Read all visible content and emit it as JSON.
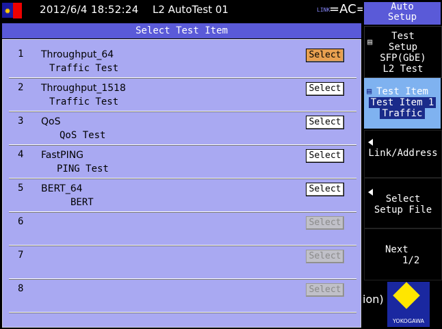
{
  "status": {
    "datetime": "2012/6/4 18:52:24",
    "title": "L2 AutoTest 01",
    "link_indicator": "LINK",
    "power": "=AC="
  },
  "header": {
    "title": "Select Test Item"
  },
  "items": [
    {
      "num": "1",
      "name": "Throughput_64",
      "desc": "Traffic Test",
      "btn": "Select"
    },
    {
      "num": "2",
      "name": "Throughput_1518",
      "desc": "Traffic Test",
      "btn": "Select"
    },
    {
      "num": "3",
      "name": "QoS",
      "desc": "QoS Test",
      "btn": "Select"
    },
    {
      "num": "4",
      "name": "FastPING",
      "desc": "PING Test",
      "btn": "Select"
    },
    {
      "num": "5",
      "name": "BERT_64",
      "desc": "BERT",
      "btn": "Select"
    },
    {
      "num": "6",
      "name": "",
      "desc": "",
      "btn": "Select"
    },
    {
      "num": "7",
      "name": "",
      "desc": "",
      "btn": "Select"
    },
    {
      "num": "8",
      "name": "",
      "desc": "",
      "btn": "Select"
    }
  ],
  "softkeys": {
    "auto_setup": {
      "line1": "Auto",
      "line2": "Setup"
    },
    "test_setup": {
      "line1": "Test",
      "line2": "Setup",
      "line3": "SFP(GbE)",
      "line4": "L2 Test"
    },
    "test_item": {
      "line1": "Test Item",
      "line2": "Test Item 1",
      "line3": "Traffic"
    },
    "link_address": {
      "label": "Link/Address"
    },
    "select_setup_file": {
      "line1": "Select",
      "line2": "Setup File"
    },
    "next": {
      "line1": "Next",
      "line2": "1/2"
    }
  },
  "bottom": {
    "partial_text": "ion)",
    "brand": "YOKOGAWA"
  }
}
